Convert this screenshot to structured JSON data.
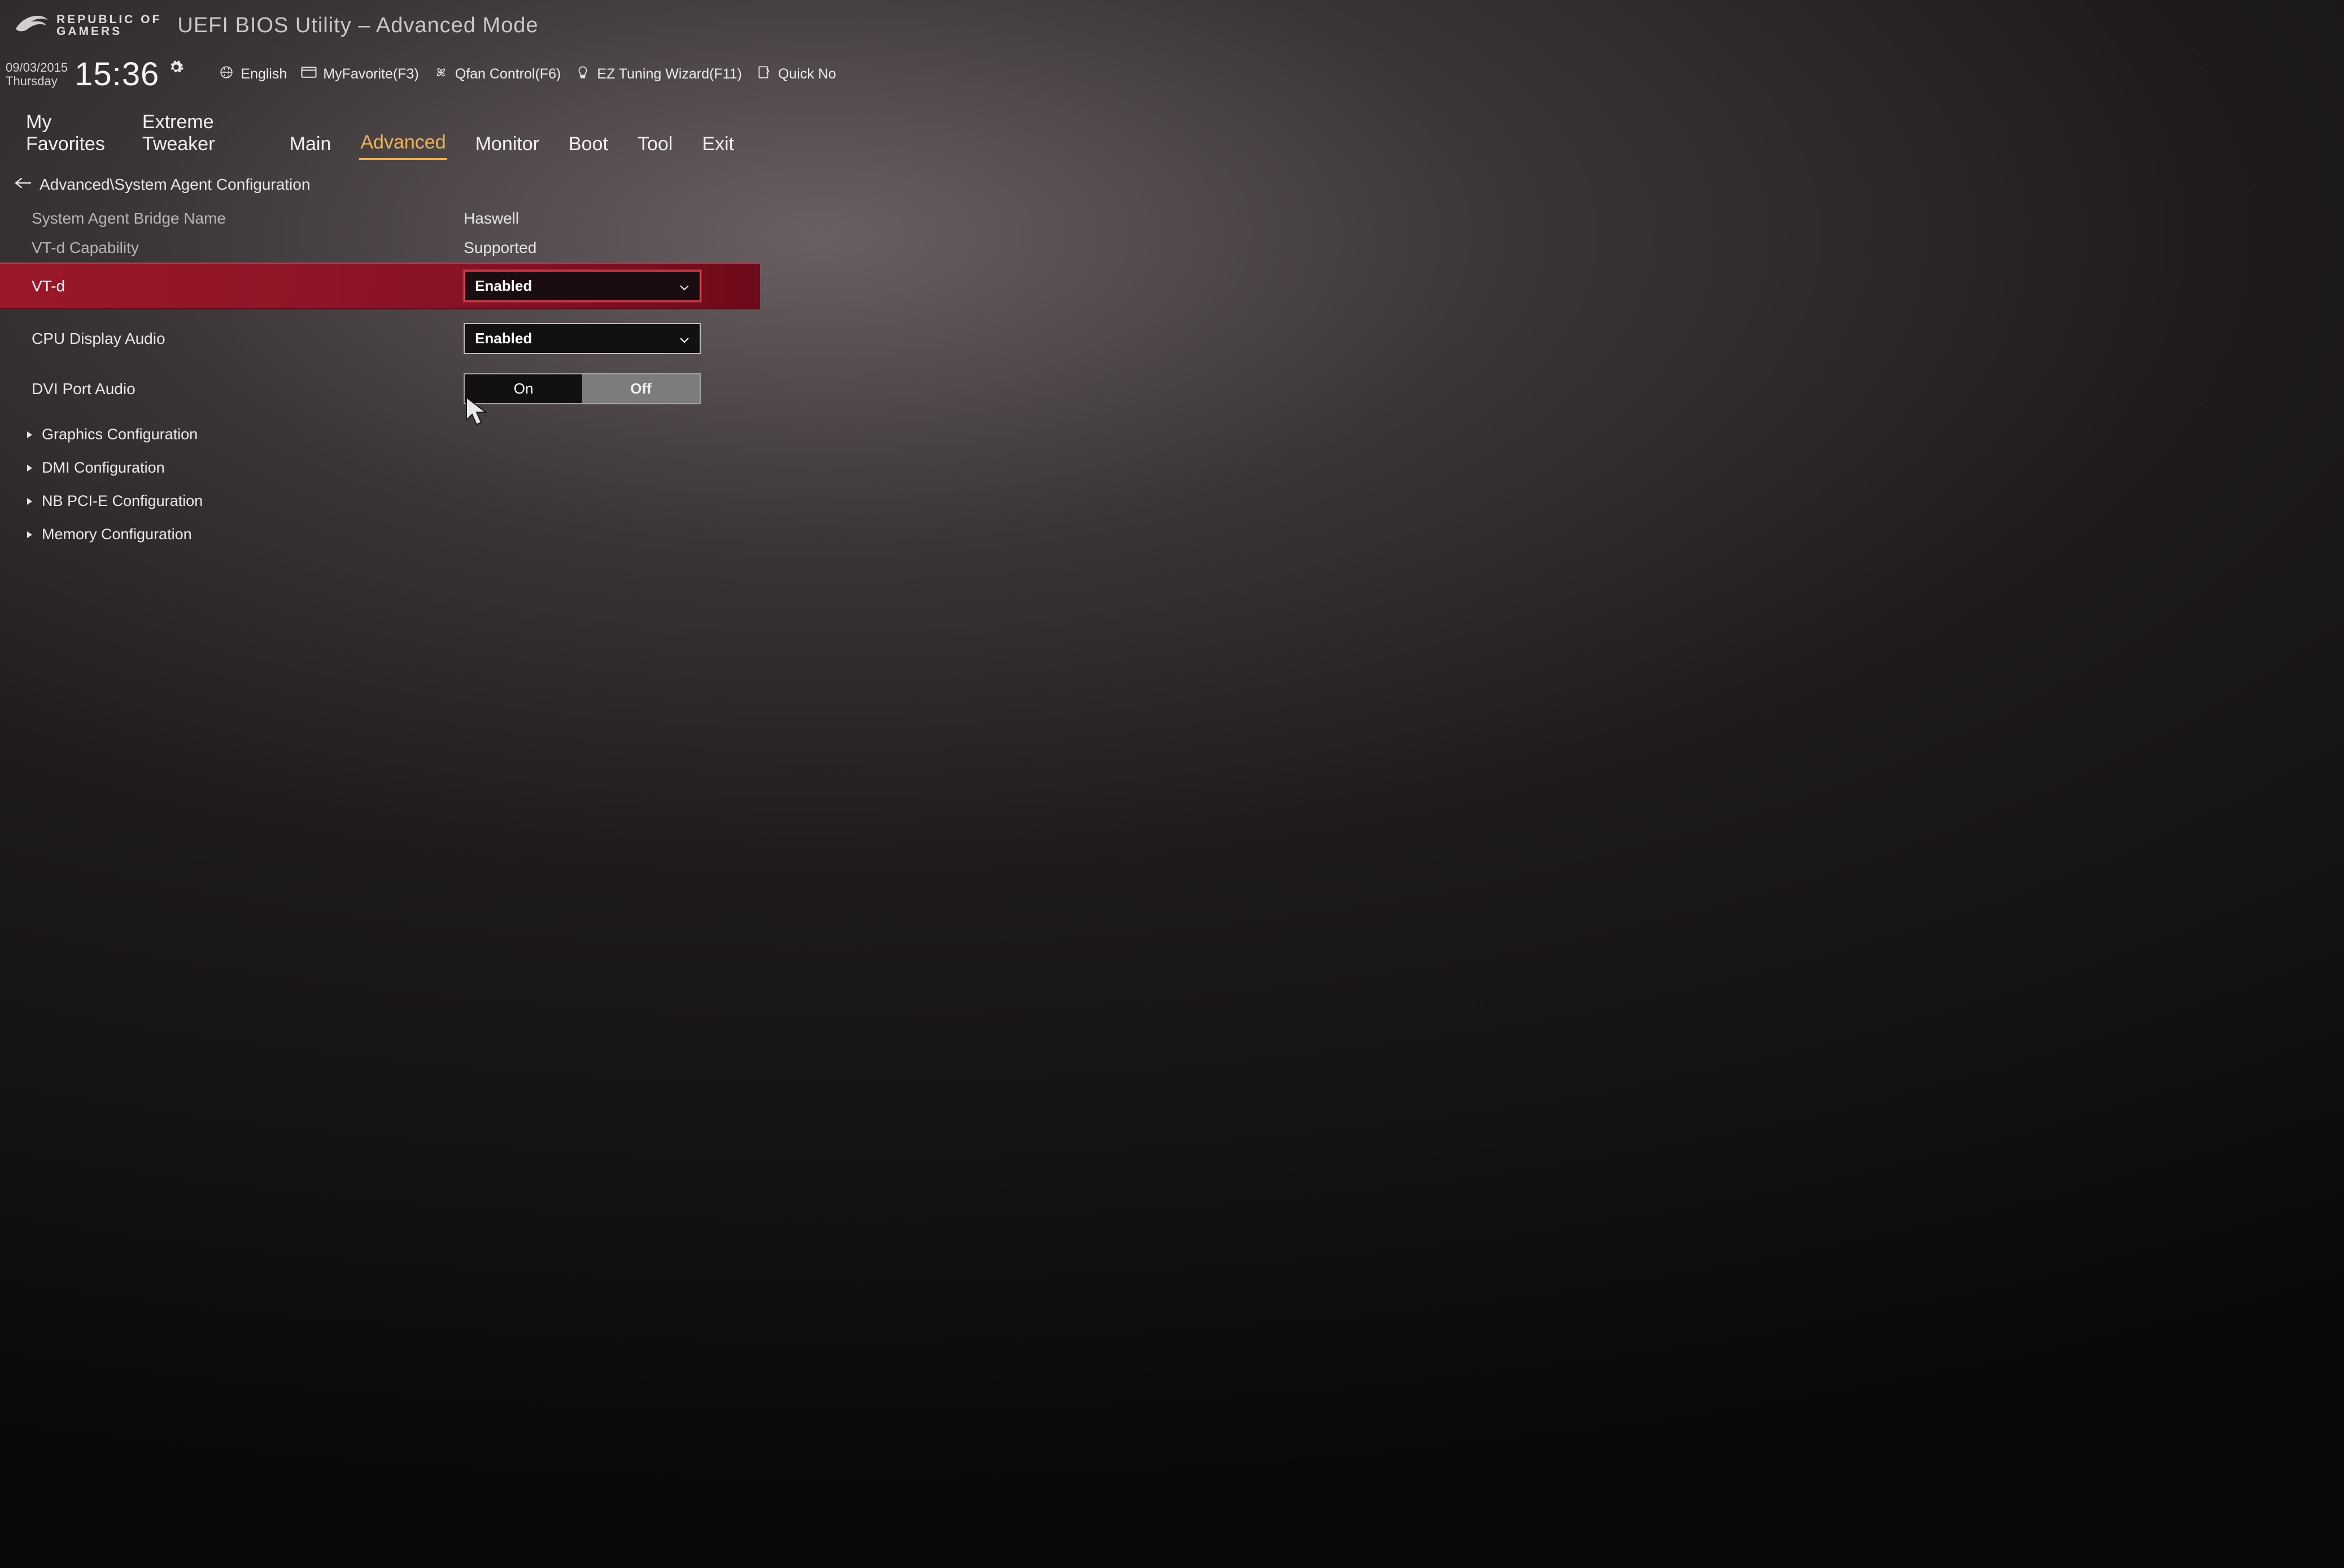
{
  "brand": {
    "line1": "REPUBLIC OF",
    "line2": "GAMERS"
  },
  "title": "UEFI BIOS Utility – Advanced Mode",
  "datetime": {
    "date": "09/03/2015",
    "day": "Thursday",
    "time": "15:36"
  },
  "toolbar": {
    "language": "English",
    "favorite": "MyFavorite(F3)",
    "qfan": "Qfan Control(F6)",
    "eztuning": "EZ Tuning Wizard(F11)",
    "quicknote": "Quick No"
  },
  "tabs": {
    "favorites": "My Favorites",
    "tweaker": "Extreme Tweaker",
    "main": "Main",
    "advanced": "Advanced",
    "monitor": "Monitor",
    "boot": "Boot",
    "tool": "Tool",
    "exit": "Exit"
  },
  "breadcrumb": "Advanced\\System Agent Configuration",
  "rows": {
    "bridge_label": "System Agent Bridge Name",
    "bridge_value": "Haswell",
    "vtd_cap_label": "VT-d Capability",
    "vtd_cap_value": "Supported",
    "vtd_label": "VT-d",
    "vtd_value": "Enabled",
    "cpu_disp_label": "CPU Display Audio",
    "cpu_disp_value": "Enabled",
    "dvi_label": "DVI Port Audio",
    "dvi_on": "On",
    "dvi_off": "Off"
  },
  "submenus": {
    "graphics": "Graphics Configuration",
    "dmi": "DMI Configuration",
    "nbpcie": "NB PCI-E Configuration",
    "memory": "Memory Configuration"
  }
}
